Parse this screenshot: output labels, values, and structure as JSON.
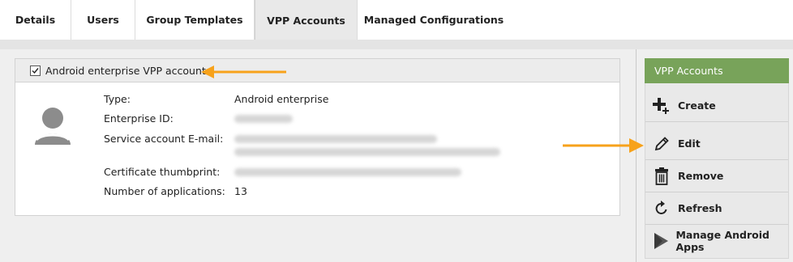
{
  "tabs": [
    {
      "label": "Details"
    },
    {
      "label": "Users"
    },
    {
      "label": "Group Templates"
    },
    {
      "label": "VPP Accounts"
    },
    {
      "label": "Managed Configurations"
    }
  ],
  "account_panel": {
    "title": "Android enterprise VPP account",
    "fields": {
      "type_label": "Type:",
      "type_value": "Android enterprise",
      "enterprise_id_label": "Enterprise ID:",
      "service_email_label": "Service account E-mail:",
      "cert_label": "Certificate thumbprint:",
      "apps_label": "Number of applications:",
      "apps_value": "13"
    }
  },
  "sidebar": {
    "title": "VPP Accounts",
    "items": [
      {
        "label": "Create",
        "icon": "plus-icon"
      },
      {
        "label": "Edit",
        "icon": "pencil-icon"
      },
      {
        "label": "Remove",
        "icon": "trash-icon"
      },
      {
        "label": "Refresh",
        "icon": "refresh-icon"
      },
      {
        "label": "Manage Android Apps",
        "icon": "play-store-icon"
      }
    ]
  },
  "colors": {
    "accent_green": "#78a35a",
    "arrow_orange": "#f7a21b"
  }
}
